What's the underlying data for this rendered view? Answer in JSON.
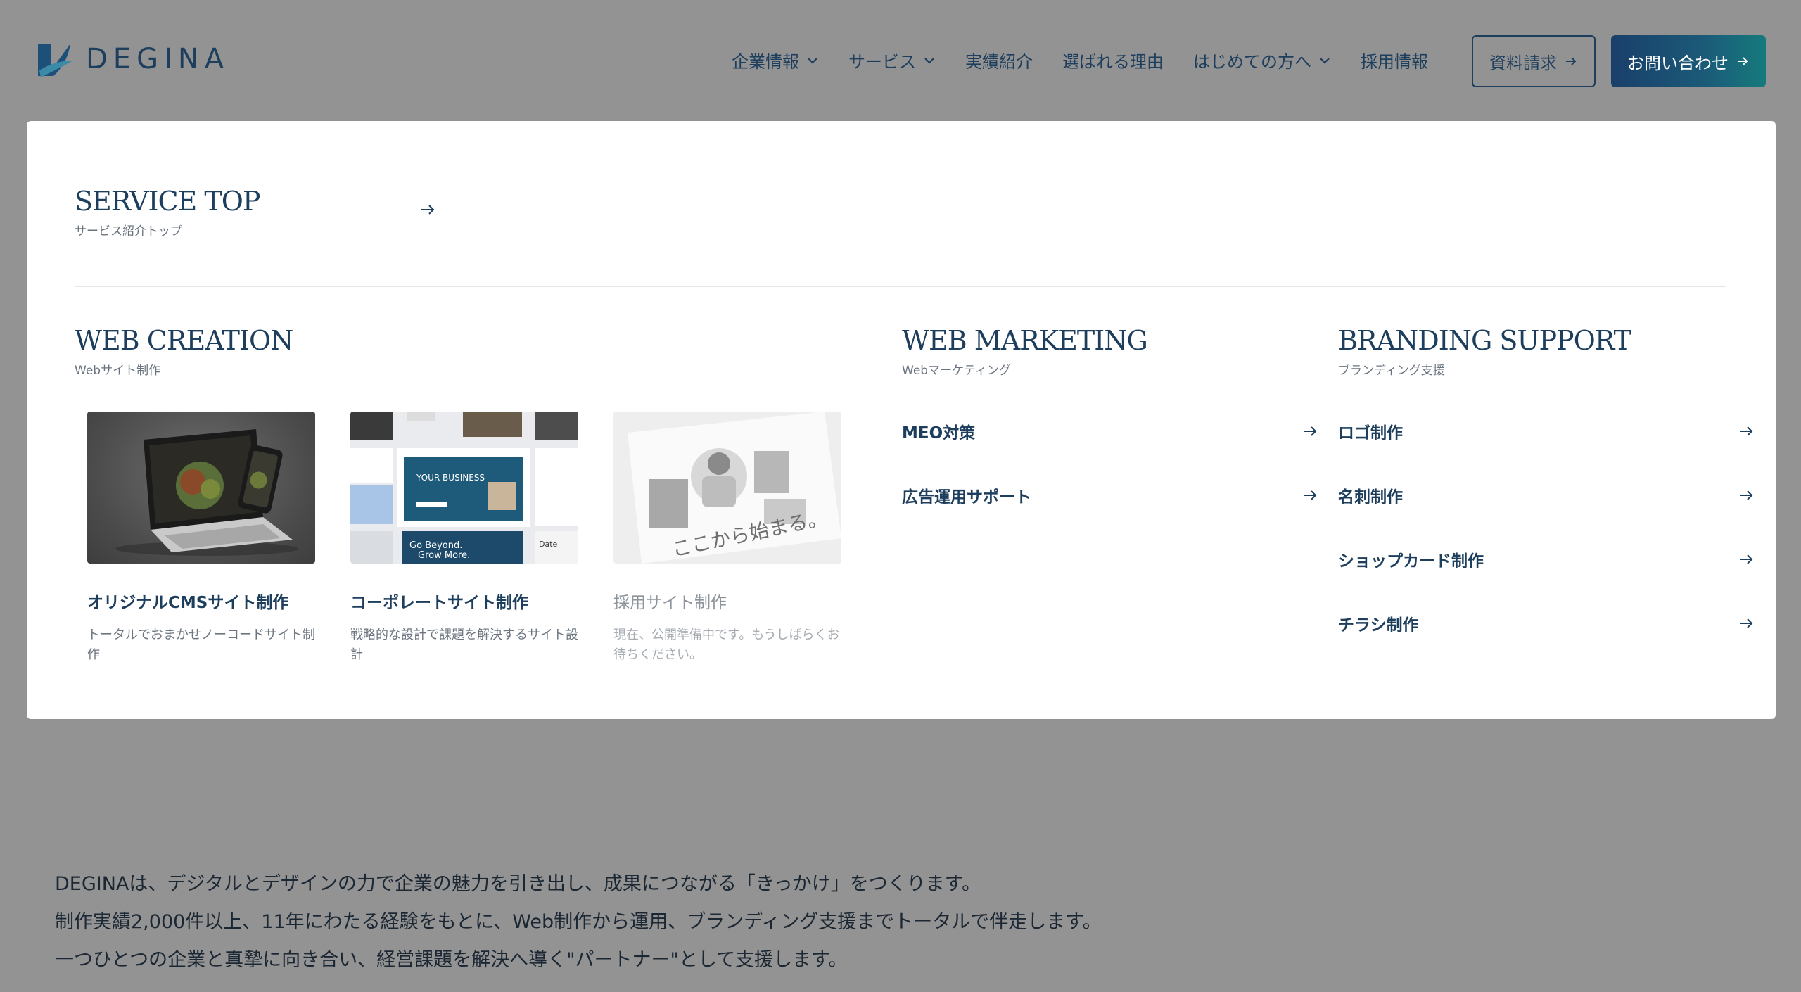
{
  "logo": {
    "text": "DEGINA"
  },
  "nav": {
    "items": [
      {
        "label": "企業情報",
        "has_dropdown": true
      },
      {
        "label": "サービス",
        "has_dropdown": true
      },
      {
        "label": "実績紹介",
        "has_dropdown": false
      },
      {
        "label": "選ばれる理由",
        "has_dropdown": false
      },
      {
        "label": "はじめての方へ",
        "has_dropdown": true
      },
      {
        "label": "採用情報",
        "has_dropdown": false
      }
    ],
    "docs_button": "資料請求",
    "contact_button": "お問い合わせ"
  },
  "menu": {
    "service_top": {
      "title": "SERVICE TOP",
      "sub": "サービス紹介トップ"
    },
    "web_creation": {
      "title": "WEB CREATION",
      "sub": "Webサイト制作",
      "cards": [
        {
          "title": "オリジナルCMSサイト制作",
          "desc": "トータルでおまかせノーコードサイト制作"
        },
        {
          "title": "コーポレートサイト制作",
          "desc": "戦略的な設計で課題を解決するサイト設計"
        },
        {
          "title": "採用サイト制作",
          "desc": "現在、公開準備中です。もうしばらくお待ちください。"
        }
      ],
      "card_image_text": {
        "your_business": "YOUR BUSINESS",
        "go_beyond": "Go Beyond.",
        "grow_more": "Grow More.",
        "date": "Date",
        "recruit_tagline": "ここから始まる。"
      }
    },
    "web_marketing": {
      "title": "WEB MARKETING",
      "sub": "Webマーケティング",
      "links": [
        "MEO対策",
        "広告運用サポート"
      ]
    },
    "branding_support": {
      "title": "BRANDING SUPPORT",
      "sub": "ブランディング支援",
      "links": [
        "ロゴ制作",
        "名刺制作",
        "ショップカード制作",
        "チラシ制作"
      ]
    }
  },
  "intro": {
    "lines": [
      "DEGINAは、デジタルとデザインの力で企業の魅力を引き出し、成果につながる「きっかけ」をつくります。",
      "制作実績2,000件以上、11年にわたる経験をもとに、Web制作から運用、ブランディング支援までトータルで伴走します。",
      "一つひとつの企業と真摯に向き合い、経営課題を解決へ導く\"パートナー\"として支援します。"
    ]
  },
  "colors": {
    "overlay": "#939393",
    "navy": "#1d3e5c",
    "primary_gradient_start": "#1a3f6a",
    "primary_gradient_end": "#167a7c"
  }
}
